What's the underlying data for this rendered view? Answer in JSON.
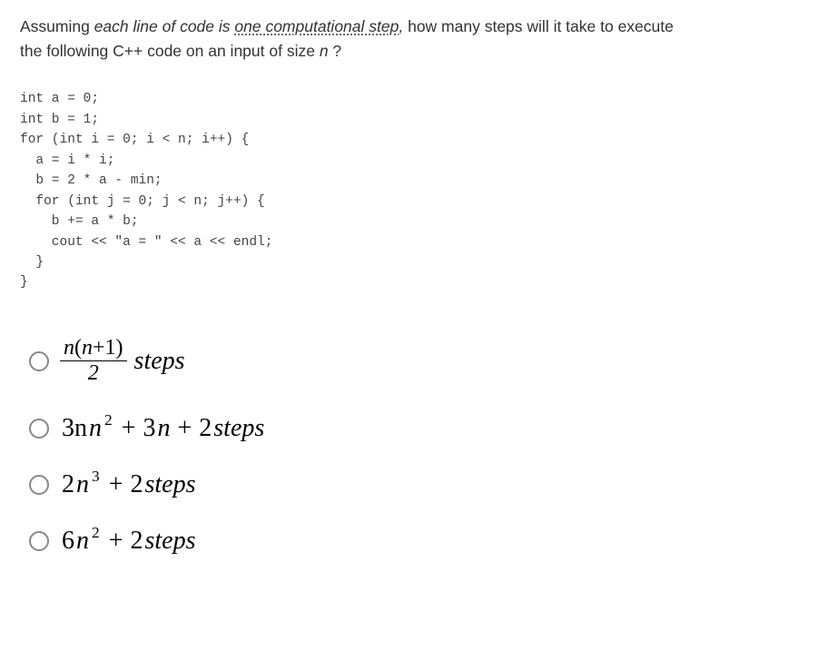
{
  "question": {
    "prefix": "Assuming ",
    "em_phrase": "each line of code is ",
    "underlined": "one computational step",
    "after_underline": ", ",
    "rest1": "how many steps will it take to execute",
    "line2_a": "the following C++ code on an input of size ",
    "var": "n",
    "line2_b": " ?"
  },
  "code": "int a = 0;\nint b = 1;\nfor (int i = 0; i < n; i++) {\n  a = i * i;\n  b = 2 * a - min;\n  for (int j = 0; j < n; j++) {\n    b += a * b;\n    cout << \"a = \" << a << endl;\n  }\n}",
  "options": {
    "a": {
      "frac_num_left": "n",
      "frac_num_paren": "(n+1)",
      "frac_den": "2",
      "suffix": " steps"
    },
    "b": {
      "t1": "3n",
      "exp1": "2",
      "t2": "3n",
      "t3": "2",
      "suffix": " steps"
    },
    "c": {
      "t1": "2n",
      "exp1": "3",
      "t2": "2",
      "suffix": " steps"
    },
    "d": {
      "t1": "6n",
      "exp1": "2",
      "t2": "2",
      "suffix": " steps"
    }
  }
}
